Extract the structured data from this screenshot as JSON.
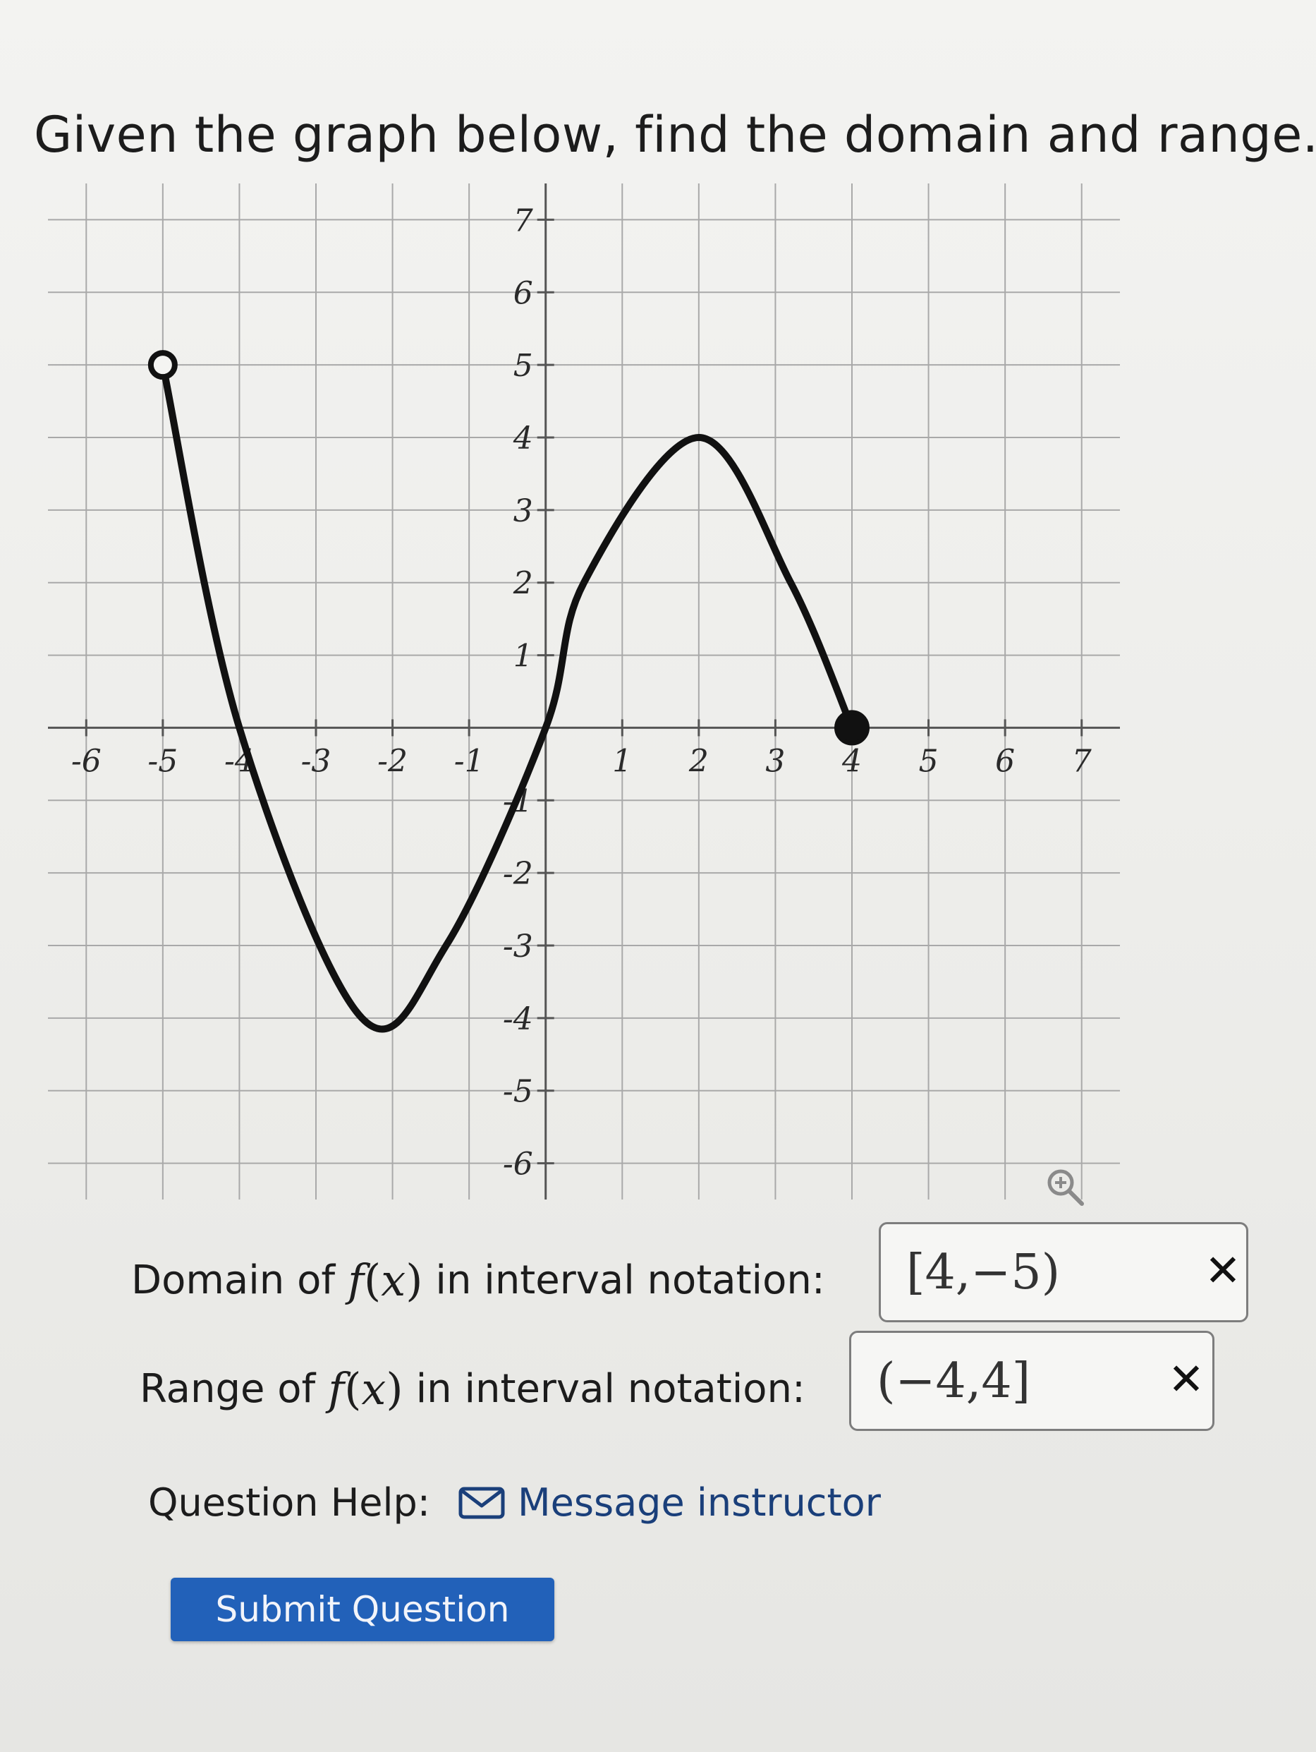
{
  "question": {
    "text": "Given the graph below, find the domain and range."
  },
  "chart_data": {
    "type": "line",
    "title": "",
    "xlabel": "",
    "ylabel": "",
    "xlim": [
      -6.5,
      7.5
    ],
    "ylim": [
      -6.5,
      7.5
    ],
    "x_ticks": [
      -6,
      -5,
      -4,
      -3,
      -2,
      -1,
      1,
      2,
      3,
      4,
      5,
      6,
      7
    ],
    "y_ticks": [
      -6,
      -5,
      -4,
      -3,
      -2,
      -1,
      1,
      2,
      3,
      4,
      5,
      6,
      7
    ],
    "grid": true,
    "series": [
      {
        "points": [
          [
            -5,
            5
          ],
          [
            -4,
            0
          ],
          [
            -2.4,
            -4
          ],
          [
            -1.3,
            -3
          ],
          [
            0,
            0
          ],
          [
            0.5,
            2
          ],
          [
            2,
            4
          ],
          [
            3.2,
            2
          ],
          [
            4,
            0
          ]
        ],
        "start": {
          "x": -5,
          "y": 5,
          "closed": false
        },
        "end": {
          "x": 4,
          "y": 0,
          "closed": true
        }
      }
    ]
  },
  "domain_row": {
    "label_prefix": "Domain of",
    "func": "f",
    "paren_open": "(",
    "var": "x",
    "paren_close": ")",
    "label_suffix": "in interval notation:",
    "answer": "[4,−5)",
    "status": "✕"
  },
  "range_row": {
    "label_prefix": "Range of",
    "func": "f",
    "paren_open": "(",
    "var": "x",
    "paren_close": ")",
    "label_suffix": "in interval notation:",
    "answer": "(−4,4]",
    "status": "✕"
  },
  "help": {
    "label": "Question Help:",
    "message_link": "Message instructor",
    "icon": "mail-icon"
  },
  "submit": {
    "label": "Submit Question",
    "color": "#2261b9"
  }
}
